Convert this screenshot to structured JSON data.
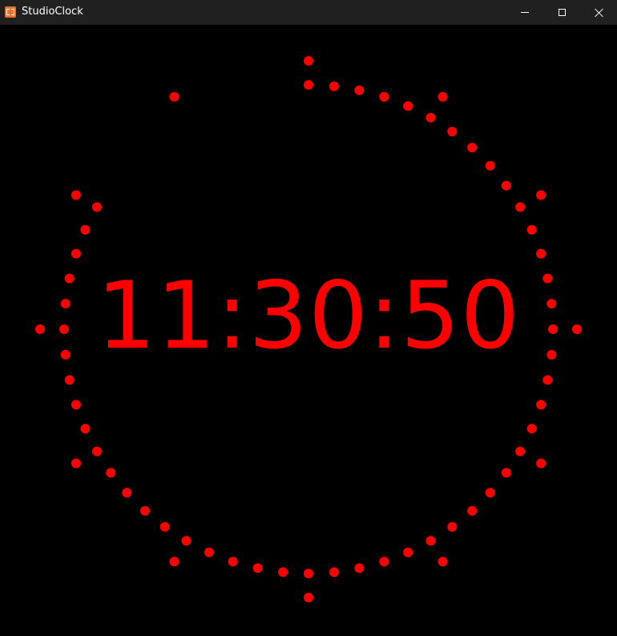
{
  "window": {
    "title": "StudioClock",
    "icon": "app-icon",
    "controls": {
      "minimize_icon": "minimize-icon",
      "maximize_icon": "maximize-icon",
      "close_icon": "close-icon"
    }
  },
  "clock": {
    "time": "11:30:50",
    "seconds_elapsed": 50,
    "color": "#ff0000",
    "background": "#000000",
    "hour_markers": 12
  }
}
